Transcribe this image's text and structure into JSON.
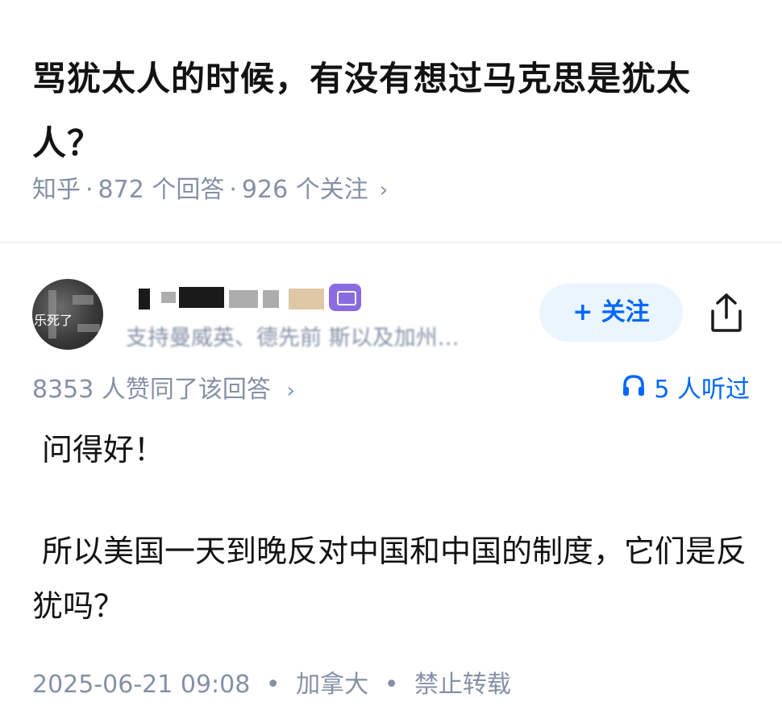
{
  "question": {
    "title": "骂犹太人的时候，有没有想过马克思是犹太人？",
    "platform": "知乎",
    "answers": "872 个回答",
    "followers": "926 个关注",
    "separator": "·",
    "chevron": "›"
  },
  "author": {
    "avatar_text": "乐死了",
    "bio": "支持曼威英、德先前 斯以及加州…",
    "follow_label": "+ 关注"
  },
  "answer": {
    "votes": "8353 人赞同了该回答",
    "chevron": "›",
    "listen_icon": "headphones-icon",
    "listeners": "5 人听过",
    "paragraphs": [
      "问得好！",
      "所以美国一天到晚反对中国和中国的制度，它们是反犹吗？"
    ],
    "timestamp": "2025-06-21 09:08",
    "location": "加拿大",
    "copyright": "禁止转载",
    "separator": "•"
  },
  "colors": {
    "accent": "#0066ff",
    "meta_grey": "#8590a6",
    "follow_bg": "#ebf5ff"
  }
}
